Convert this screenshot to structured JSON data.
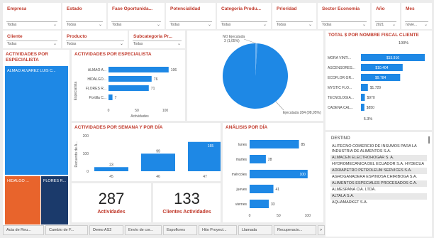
{
  "filters": [
    {
      "title": "Empresa",
      "value": "Todas"
    },
    {
      "title": "Estado",
      "value": "Todas"
    },
    {
      "title": "Fase Oportunida...",
      "value": "Todas"
    },
    {
      "title": "Potencialidad",
      "value": "Todas"
    },
    {
      "title": "Categoria Produ...",
      "value": "Todas"
    },
    {
      "title": "Prioridad",
      "value": "Todas"
    },
    {
      "title": "Sector Economia",
      "value": "Todas"
    },
    {
      "title": "Año",
      "value": "2021"
    },
    {
      "title": "Mes",
      "value": "novie..."
    }
  ],
  "filters2": [
    {
      "title": "Cliente",
      "value": "Todas"
    },
    {
      "title": "Producto",
      "value": "Todas"
    },
    {
      "title": "Subcategoria Pr...",
      "value": "Todas"
    }
  ],
  "treemap": {
    "title_line1": "ACTIVIDADES POR",
    "title_line2": "ESPECIALISTA",
    "tiles": [
      {
        "label": "ALMAO ALVAREZ LUIS C...",
        "color": "#1e88e5"
      },
      {
        "label": "HIDALGO ...",
        "color": "#e8642c"
      },
      {
        "label": "FLORES R...",
        "color": "#1b3a6b"
      }
    ]
  },
  "especialista_chart": {
    "title": "ACTIVIDADES POR ESPECIALISTA",
    "ylabel": "Especialista",
    "xlabel": "Actividades",
    "ticks": [
      "0",
      "50",
      "100"
    ]
  },
  "pie": {
    "label_no": "NO Ejecutada",
    "label_no_val": "3 (1,05%)",
    "label_ej": "Ejecutada 284 (98,95%)"
  },
  "cliente_chart": {
    "title": "TOTAL $ POR NOMBRE FISCAL CLIENTE",
    "pct_top": "100%",
    "pct_bottom": "5.3%"
  },
  "semana_chart": {
    "title": "ACTIVIDADES POR SEMANA Y POR DÍA",
    "ylabel": "Recuento de A...",
    "yticks": [
      "200",
      "100",
      "0"
    ]
  },
  "dia_chart": {
    "title": "ANÁLISIS POR DÍA",
    "ticks": [
      "0",
      "50",
      "100"
    ]
  },
  "kpis": [
    {
      "value": "287",
      "label": "Actividades"
    },
    {
      "value": "133",
      "label": "Clientes Actividades"
    }
  ],
  "destino": {
    "header": "DESTINO",
    "items": [
      "ALITECNO COMERCIO DE INSUMOS PARA LA INDUSTRIA DE ALIMENTOS S.A.",
      "ALMACEN ELECTROHOGAR S. A.",
      "HYDROMECANICA DEL ECUADOR S.A. HYDECUA",
      "ADRIAPETRO PETROLEUM SERVICES S.A.",
      "AGROGANADERA ESPINOSA CHIRIBOGA S.A.",
      "ALIMENTOS ESPECIALES PROCESADOS C.A.",
      "ALMESPANA CIA. LTDA.",
      "ALTALA S.A.",
      "AQUAMARKET S.A."
    ]
  },
  "tabs": [
    "Acta de Reu...",
    "Cambio de F...",
    "Demo AS2",
    "Envío de cor...",
    "Espoflores",
    "Hito Proyect...",
    "Llamada",
    "Recuperacio...",
    ">"
  ],
  "chart_data": [
    {
      "type": "bar",
      "title": "ACTIVIDADES POR ESPECIALISTA",
      "categories": [
        "ALMAO A...",
        "HIDALGO...",
        "FLORES R...",
        "Portilla C..."
      ],
      "values": [
        106,
        76,
        71,
        7
      ],
      "xlabel": "Actividades",
      "ylabel": "Especialista",
      "xlim": [
        0,
        110
      ]
    },
    {
      "type": "pie",
      "categories": [
        "NO Ejecutada",
        "Ejecutada"
      ],
      "values": [
        3,
        284
      ],
      "colors": [
        "#6ab0f0",
        "#1e88e5"
      ]
    },
    {
      "type": "bar",
      "title": "TOTAL $ POR NOMBRE FISCAL CLIENTE",
      "categories": [
        "MORA VINTI...",
        "ASCENSORES...",
        "ECOFLOR GR...",
        "MYSTIC FLO...",
        "TECNOLOGIA...",
        "CADENA CAL..."
      ],
      "values": [
        15916,
        10404,
        9784,
        1729,
        970,
        850
      ],
      "labels": [
        "$15.916",
        "$10.404",
        "$9.784",
        "$1.729",
        "$970",
        "$850"
      ]
    },
    {
      "type": "bar",
      "title": "ACTIVIDADES POR SEMANA Y POR DÍA",
      "categories": [
        "45",
        "46",
        "47"
      ],
      "values": [
        23,
        99,
        165
      ],
      "ylabel": "Recuento de A...",
      "ylim": [
        0,
        200
      ]
    },
    {
      "type": "bar",
      "title": "ANÁLISIS POR DÍA",
      "categories": [
        "lunes",
        "martes",
        "miércoles",
        "jueves",
        "viernes"
      ],
      "values": [
        85,
        28,
        100,
        41,
        33
      ],
      "xlim": [
        0,
        110
      ]
    }
  ]
}
